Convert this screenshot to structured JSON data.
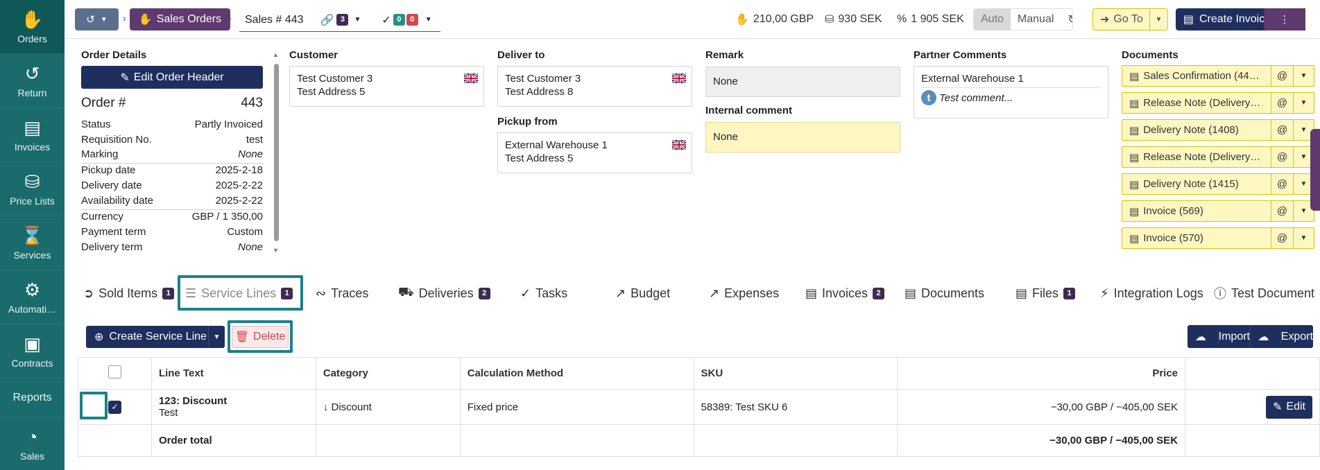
{
  "sidebar": {
    "items": [
      {
        "label": "Orders",
        "icon": "hand-coins-icon"
      },
      {
        "label": "Return",
        "icon": "undo-icon"
      },
      {
        "label": "Invoices",
        "icon": "document-icon"
      },
      {
        "label": "Price Lists",
        "icon": "coins-icon"
      },
      {
        "label": "Services",
        "icon": "hourglass-icon"
      },
      {
        "label": "Automati…",
        "icon": "robot-icon"
      },
      {
        "label": "Contracts",
        "icon": "contract-icon"
      },
      {
        "label": "Reports",
        "icon": ""
      },
      {
        "label": "Sales",
        "icon": "pie-chart-icon"
      }
    ]
  },
  "topbar": {
    "sales_orders_label": "Sales Orders",
    "order_tab_label": "Sales # 443",
    "link_count": "3",
    "check_ok_count": "0",
    "check_fail_count": "0",
    "stat1": "210,00 GBP",
    "stat2": "930 SEK",
    "stat3": "1 905 SEK",
    "auto_label": "Auto",
    "manual_label": "Manual",
    "goto_label": "Go To",
    "create_invoice_label": "Create Invoice"
  },
  "order_details": {
    "title": "Order Details",
    "edit_header_label": "Edit Order Header",
    "order_no_label": "Order #",
    "order_no_value": "443",
    "status_label": "Status",
    "status_value": "Partly Invoiced",
    "requisition_label": "Requisition No.",
    "requisition_value": "test",
    "marking_label": "Marking",
    "marking_value": "None",
    "pickup_date_label": "Pickup date",
    "pickup_date_value": "2025-2-18",
    "delivery_date_label": "Delivery date",
    "delivery_date_value": "2025-2-22",
    "availability_label": "Availability date",
    "availability_value": "2025-2-22",
    "currency_label": "Currency",
    "currency_value": "GBP / 1 350,00",
    "payment_label": "Payment term",
    "payment_value": "Custom",
    "delivery_term_label": "Delivery term",
    "delivery_term_value": "None"
  },
  "customer": {
    "title": "Customer",
    "line1": "Test Customer 3",
    "line2": "Test Address 5"
  },
  "deliver_to": {
    "title": "Deliver to",
    "line1": "Test Customer 3",
    "line2": "Test Address 8"
  },
  "pickup_from": {
    "title": "Pickup from",
    "line1": "External Warehouse 1",
    "line2": "Test Address 5"
  },
  "remark": {
    "title": "Remark",
    "value": "None"
  },
  "internal_comment": {
    "title": "Internal comment",
    "value": "None"
  },
  "partner_comments": {
    "title": "Partner Comments",
    "line1": "External Warehouse 1",
    "avatar_letter": "t",
    "comment": "Test comment..."
  },
  "documents": {
    "title": "Documents",
    "at_label": "@",
    "items": [
      {
        "label": "Sales Confirmation (44…",
        "icon": "pdf-icon"
      },
      {
        "label": "Release Note (Delivery…",
        "icon": "pdf-icon"
      },
      {
        "label": "Delivery Note (1408)",
        "icon": "pdf-icon"
      },
      {
        "label": "Release Note (Delivery…",
        "icon": "pdf-icon"
      },
      {
        "label": "Delivery Note (1415)",
        "icon": "pdf-icon"
      },
      {
        "label": "Invoice (569)",
        "icon": "invoice-icon"
      },
      {
        "label": "Invoice (570)",
        "icon": "invoice-icon"
      }
    ]
  },
  "tabs": {
    "sold_items": "Sold Items",
    "sold_items_count": "1",
    "service_lines": "Service Lines",
    "service_lines_count": "1",
    "traces": "Traces",
    "deliveries": "Deliveries",
    "deliveries_count": "2",
    "tasks": "Tasks",
    "budget": "Budget",
    "expenses": "Expenses",
    "invoices": "Invoices",
    "invoices_count": "2",
    "documents": "Documents",
    "files": "Files",
    "files_count": "1",
    "integration_logs": "Integration Logs",
    "test_document": "Test Document"
  },
  "toolbar": {
    "create_service_line": "Create Service Line",
    "delete": "Delete",
    "import": "Import",
    "export": "Export"
  },
  "table": {
    "headers": {
      "line_text": "Line Text",
      "category": "Category",
      "calc_method": "Calculation Method",
      "sku": "SKU",
      "price": "Price"
    },
    "row": {
      "title": "123: Discount",
      "subtitle": "Test",
      "category": "Discount",
      "calc_method": "Fixed price",
      "sku": "58389: Test SKU 6",
      "price": "−30,00 GBP / −405,00 SEK",
      "edit_label": "Edit"
    },
    "total": {
      "label": "Order total",
      "price": "−30,00 GBP / −405,00 SEK"
    }
  },
  "colors": {
    "sidebar": "#1a6b6b",
    "primary": "#1e2f5e",
    "purple": "#5e3a6e",
    "highlight": "#1a8189"
  }
}
